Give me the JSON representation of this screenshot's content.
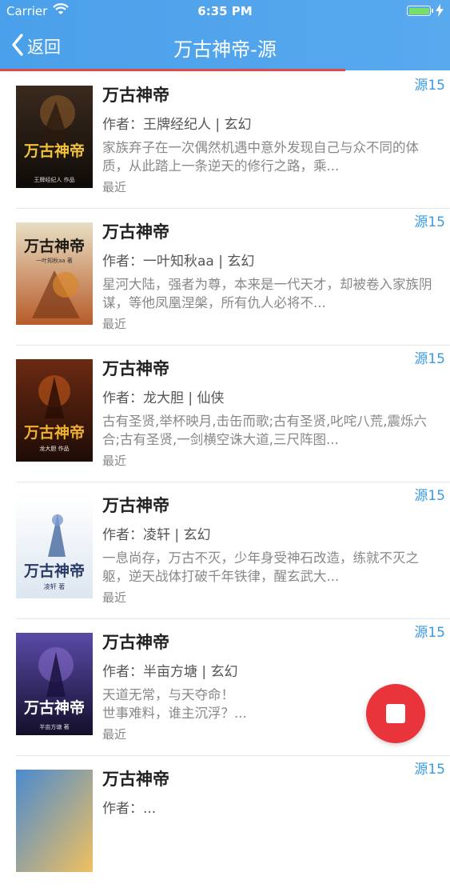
{
  "status_bar": {
    "carrier": "Carrier",
    "time": "6:35 PM"
  },
  "nav": {
    "back_label": "返回",
    "title": "万古神帝-源"
  },
  "books": [
    {
      "title": "万古神帝",
      "meta": "作者：王牌经纪人 | 玄幻",
      "desc": "家族弃子在一次偶然机遇中意外发现自己与众不同的体质，从此踏上一条逆天的修行之路，乘...",
      "latest": "最近",
      "source": "源15",
      "cover": {
        "bg1": "#3a2a1e",
        "bg2": "#0f0b08",
        "text": "万古神帝",
        "text_color": "#f2c23a",
        "sub": "王牌经纪人 作品"
      }
    },
    {
      "title": "万古神帝",
      "meta": "作者：一叶知秋aa | 玄幻",
      "desc": "星河大陆，强者为尊，本来是一代天才，却被卷入家族阴谋，等他凤凰涅槃，所有仇人必将不...",
      "latest": "最近",
      "source": "源15",
      "cover": {
        "bg1": "#e8dfc4",
        "bg2": "#b85b2a",
        "text": "万古神帝",
        "text_color": "#1d1a16",
        "sub": "一叶知秋aa 著"
      }
    },
    {
      "title": "万古神帝",
      "meta": "作者：龙大胆 | 仙侠",
      "desc": "古有圣贤,举杯映月,击缶而歌;古有圣贤,叱咤八荒,震烁六合;古有圣贤,一剑横空诛大道,三尺阵图...",
      "latest": "最近",
      "source": "源15",
      "cover": {
        "bg1": "#6b2a12",
        "bg2": "#1e0c06",
        "text": "万古神帝",
        "text_color": "#f0b030",
        "sub": "龙大胆 作品"
      }
    },
    {
      "title": "万古神帝",
      "meta": "作者：凌轩 | 玄幻",
      "desc": "一息尚存，万古不灭，少年身受神石改造，练就不灭之躯，逆天战体打破千年铁律，醒玄武大...",
      "latest": "最近",
      "source": "源15",
      "cover": {
        "bg1": "#ffffff",
        "bg2": "#dce6f0",
        "text": "万古神帝",
        "text_color": "#2a3a66",
        "sub": "凌轩 著"
      }
    },
    {
      "title": "万古神帝",
      "meta": "作者：半亩方塘 | 玄幻",
      "desc": "天道无常，与天夺命！\n世事难料，谁主沉浮？...",
      "latest": "最近",
      "source": "源15",
      "cover": {
        "bg1": "#5a4aa8",
        "bg2": "#130f2a",
        "text": "万古神帝",
        "text_color": "#ffffff",
        "sub": "半亩方塘 著"
      }
    },
    {
      "title": "万古神帝",
      "meta": "作者：...",
      "desc": "",
      "latest": "",
      "source": "源15",
      "cover": {
        "bg1": "#4a8ad0",
        "bg2": "#f0c060",
        "text": "",
        "text_color": "#ffffff",
        "sub": ""
      }
    }
  ],
  "colors": {
    "header": "#4aa0ea",
    "accent": "#3a9be0",
    "progress": "#e24a4a",
    "fab": "#e8343a"
  },
  "icons": {
    "back": "chevron-left-icon",
    "wifi": "wifi-icon",
    "battery": "battery-icon",
    "stop": "stop-icon"
  }
}
